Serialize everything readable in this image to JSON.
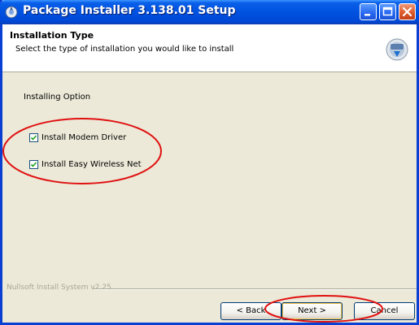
{
  "window": {
    "title": "Package Installer 3.138.01 Setup"
  },
  "header": {
    "title": "Installation Type",
    "subtitle": "Select the type of installation you would like to install"
  },
  "body": {
    "installing_option_label": "Installing Option",
    "options": [
      {
        "label": "Install Modem Driver",
        "checked": true
      },
      {
        "label": "Install Easy Wireless Net",
        "checked": true
      }
    ]
  },
  "footer": {
    "branding": "Nullsoft Install System v2.25",
    "back_label": "< Back",
    "next_label": "Next >",
    "cancel_label": "Cancel"
  },
  "colors": {
    "titlebar": "#0052e0",
    "annotation_red": "#e01010",
    "dialog_bg": "#ece9d8"
  }
}
